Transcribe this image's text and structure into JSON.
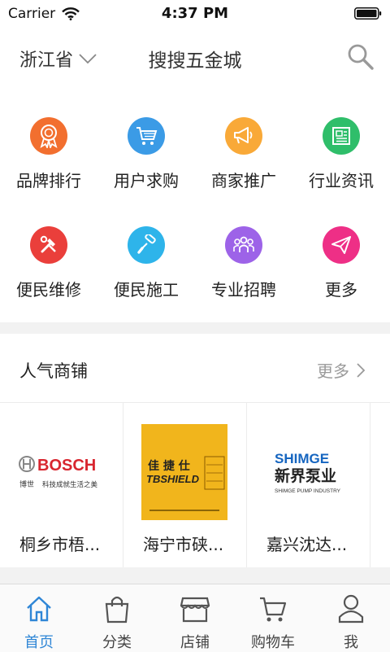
{
  "status_bar": {
    "carrier": "Carrier",
    "time": "4:37 PM"
  },
  "nav": {
    "region": "浙江省",
    "title": "搜搜五金城"
  },
  "categories": [
    {
      "label": "品牌排行",
      "icon": "award-ribbon-icon",
      "color": "#f26f2f"
    },
    {
      "label": "用户求购",
      "icon": "shopping-cart-icon",
      "color": "#3b9be6"
    },
    {
      "label": "商家推广",
      "icon": "megaphone-icon",
      "color": "#f9a938"
    },
    {
      "label": "行业资讯",
      "icon": "newspaper-icon",
      "color": "#2fbe6a"
    },
    {
      "label": "便民维修",
      "icon": "tools-icon",
      "color": "#ea3f3b"
    },
    {
      "label": "便民施工",
      "icon": "paint-roller-icon",
      "color": "#2eb4ea"
    },
    {
      "label": "专业招聘",
      "icon": "people-group-icon",
      "color": "#9d63e8"
    },
    {
      "label": "更多",
      "icon": "paper-plane-icon",
      "color": "#ee2f86"
    }
  ],
  "shops_section": {
    "title": "人气商铺",
    "more": "更多"
  },
  "shops": [
    {
      "name": "桐乡市梧...",
      "logo_main": "BOSCH",
      "logo_cn": "博世",
      "logo_slogan": "科技成就生活之美"
    },
    {
      "name": "海宁市硖...",
      "logo_main": "TBSHIELD",
      "logo_cn": "佳 捷 仕"
    },
    {
      "name": "嘉兴沈达...",
      "logo_main": "SHIMGE",
      "logo_cn": "新界泵业",
      "logo_sub": "SHIMGE PUMP INDUSTRY"
    }
  ],
  "tabs": [
    {
      "label": "首页",
      "icon": "home-icon",
      "active": true
    },
    {
      "label": "分类",
      "icon": "shopping-bag-icon",
      "active": false
    },
    {
      "label": "店铺",
      "icon": "storefront-icon",
      "active": false
    },
    {
      "label": "购物车",
      "icon": "cart-icon",
      "active": false
    },
    {
      "label": "我",
      "icon": "person-icon",
      "active": false
    }
  ],
  "colors": {
    "accent": "#2f86d6",
    "bosch_red": "#d8262f",
    "tbshield_yellow": "#f1b51c",
    "shimge_blue": "#1565c0"
  }
}
